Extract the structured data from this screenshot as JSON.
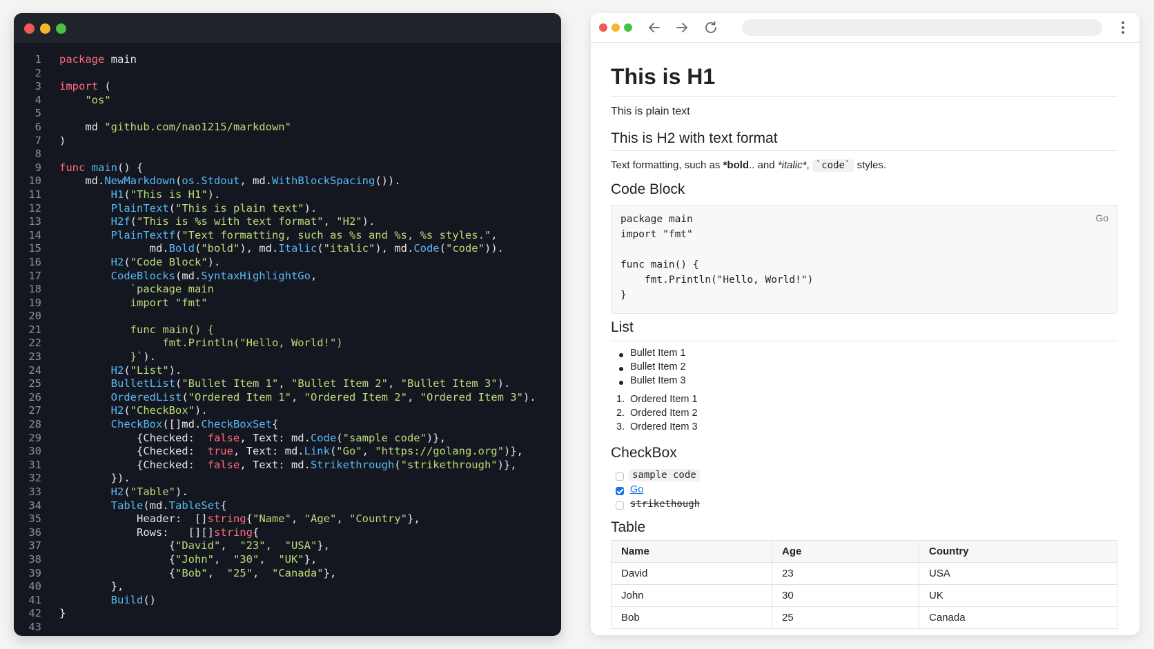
{
  "editor": {
    "code_lines": [
      [
        [
          "kw",
          "package"
        ],
        [
          "pl",
          " main"
        ]
      ],
      [],
      [
        [
          "kw",
          "import"
        ],
        [
          "pl",
          " ("
        ]
      ],
      [
        [
          "pl",
          "    "
        ],
        [
          "str",
          "\"os\""
        ]
      ],
      [],
      [
        [
          "pl",
          "    md "
        ],
        [
          "str",
          "\"github.com/nao1215/markdown\""
        ]
      ],
      [
        [
          "pl",
          ")"
        ]
      ],
      [],
      [
        [
          "kw",
          "func"
        ],
        [
          "pl",
          " "
        ],
        [
          "fn",
          "main"
        ],
        [
          "pl",
          "() {"
        ]
      ],
      [
        [
          "pl",
          "    md."
        ],
        [
          "fn",
          "NewMarkdown"
        ],
        [
          "pl",
          "("
        ],
        [
          "fn",
          "os.Stdout"
        ],
        [
          "pl",
          ", md."
        ],
        [
          "fn",
          "WithBlockSpacing"
        ],
        [
          "pl",
          "())."
        ]
      ],
      [
        [
          "pl",
          "        "
        ],
        [
          "fn",
          "H1"
        ],
        [
          "pl",
          "("
        ],
        [
          "str",
          "\"This is H1\""
        ],
        [
          "pl",
          ")."
        ]
      ],
      [
        [
          "pl",
          "        "
        ],
        [
          "fn",
          "PlainText"
        ],
        [
          "pl",
          "("
        ],
        [
          "str",
          "\"This is plain text\""
        ],
        [
          "pl",
          ")."
        ]
      ],
      [
        [
          "pl",
          "        "
        ],
        [
          "fn",
          "H2f"
        ],
        [
          "pl",
          "("
        ],
        [
          "str",
          "\"This is %s with text format\""
        ],
        [
          "pl",
          ", "
        ],
        [
          "str",
          "\"H2\""
        ],
        [
          "pl",
          ")."
        ]
      ],
      [
        [
          "pl",
          "        "
        ],
        [
          "fn",
          "PlainTextf"
        ],
        [
          "pl",
          "("
        ],
        [
          "str",
          "\"Text formatting, such as %s and %s, %s styles.\""
        ],
        [
          "pl",
          ","
        ]
      ],
      [
        [
          "pl",
          "              md."
        ],
        [
          "fn",
          "Bold"
        ],
        [
          "pl",
          "("
        ],
        [
          "str",
          "\"bold\""
        ],
        [
          "pl",
          "), md."
        ],
        [
          "fn",
          "Italic"
        ],
        [
          "pl",
          "("
        ],
        [
          "str",
          "\"italic\""
        ],
        [
          "pl",
          "), md."
        ],
        [
          "fn",
          "Code"
        ],
        [
          "pl",
          "("
        ],
        [
          "str",
          "\"code\""
        ],
        [
          "pl",
          "))."
        ]
      ],
      [
        [
          "pl",
          "        "
        ],
        [
          "fn",
          "H2"
        ],
        [
          "pl",
          "("
        ],
        [
          "str",
          "\"Code Block\""
        ],
        [
          "pl",
          ")."
        ]
      ],
      [
        [
          "pl",
          "        "
        ],
        [
          "fn",
          "CodeBlocks"
        ],
        [
          "pl",
          "(md."
        ],
        [
          "fn",
          "SyntaxHighlightGo"
        ],
        [
          "pl",
          ","
        ]
      ],
      [
        [
          "pl",
          "           "
        ],
        [
          "str",
          "`package main"
        ]
      ],
      [
        [
          "pl",
          "           "
        ],
        [
          "str",
          "import \"fmt\""
        ]
      ],
      [],
      [
        [
          "pl",
          "           "
        ],
        [
          "str",
          "func main() {"
        ]
      ],
      [
        [
          "pl",
          "                "
        ],
        [
          "str",
          "fmt.Println(\"Hello, World!\")"
        ]
      ],
      [
        [
          "pl",
          "           "
        ],
        [
          "str",
          "}`"
        ],
        [
          "pl",
          ")."
        ]
      ],
      [
        [
          "pl",
          "        "
        ],
        [
          "fn",
          "H2"
        ],
        [
          "pl",
          "("
        ],
        [
          "str",
          "\"List\""
        ],
        [
          "pl",
          ")."
        ]
      ],
      [
        [
          "pl",
          "        "
        ],
        [
          "fn",
          "BulletList"
        ],
        [
          "pl",
          "("
        ],
        [
          "str",
          "\"Bullet Item 1\""
        ],
        [
          "pl",
          ", "
        ],
        [
          "str",
          "\"Bullet Item 2\""
        ],
        [
          "pl",
          ", "
        ],
        [
          "str",
          "\"Bullet Item 3\""
        ],
        [
          "pl",
          ")."
        ]
      ],
      [
        [
          "pl",
          "        "
        ],
        [
          "fn",
          "OrderedList"
        ],
        [
          "pl",
          "("
        ],
        [
          "str",
          "\"Ordered Item 1\""
        ],
        [
          "pl",
          ", "
        ],
        [
          "str",
          "\"Ordered Item 2\""
        ],
        [
          "pl",
          ", "
        ],
        [
          "str",
          "\"Ordered Item 3\""
        ],
        [
          "pl",
          ")."
        ]
      ],
      [
        [
          "pl",
          "        "
        ],
        [
          "fn",
          "H2"
        ],
        [
          "pl",
          "("
        ],
        [
          "str",
          "\"CheckBox\""
        ],
        [
          "pl",
          ")."
        ]
      ],
      [
        [
          "pl",
          "        "
        ],
        [
          "fn",
          "CheckBox"
        ],
        [
          "pl",
          "([]md."
        ],
        [
          "fn",
          "CheckBoxSet"
        ],
        [
          "pl",
          "{"
        ]
      ],
      [
        [
          "pl",
          "            {Checked:  "
        ],
        [
          "kw",
          "false"
        ],
        [
          "pl",
          ", Text: md."
        ],
        [
          "fn",
          "Code"
        ],
        [
          "pl",
          "("
        ],
        [
          "str",
          "\"sample code\""
        ],
        [
          "pl",
          ")},"
        ]
      ],
      [
        [
          "pl",
          "            {Checked:  "
        ],
        [
          "kw",
          "true"
        ],
        [
          "pl",
          ", Text: md."
        ],
        [
          "fn",
          "Link"
        ],
        [
          "pl",
          "("
        ],
        [
          "str",
          "\"Go\""
        ],
        [
          "pl",
          ", "
        ],
        [
          "str",
          "\"https://golang.org\""
        ],
        [
          "pl",
          ")},"
        ]
      ],
      [
        [
          "pl",
          "            {Checked:  "
        ],
        [
          "kw",
          "false"
        ],
        [
          "pl",
          ", Text: md."
        ],
        [
          "fn",
          "Strikethrough"
        ],
        [
          "pl",
          "("
        ],
        [
          "str",
          "\"strikethrough\""
        ],
        [
          "pl",
          ")},"
        ]
      ],
      [
        [
          "pl",
          "        })."
        ]
      ],
      [
        [
          "pl",
          "        "
        ],
        [
          "fn",
          "H2"
        ],
        [
          "pl",
          "("
        ],
        [
          "str",
          "\"Table\""
        ],
        [
          "pl",
          ")."
        ]
      ],
      [
        [
          "pl",
          "        "
        ],
        [
          "fn",
          "Table"
        ],
        [
          "pl",
          "(md."
        ],
        [
          "fn",
          "TableSet"
        ],
        [
          "pl",
          "{"
        ]
      ],
      [
        [
          "pl",
          "            Header:  []"
        ],
        [
          "kw",
          "string"
        ],
        [
          "pl",
          "{"
        ],
        [
          "str",
          "\"Name\""
        ],
        [
          "pl",
          ", "
        ],
        [
          "str",
          "\"Age\""
        ],
        [
          "pl",
          ", "
        ],
        [
          "str",
          "\"Country\""
        ],
        [
          "pl",
          "},"
        ]
      ],
      [
        [
          "pl",
          "            Rows:   [][]"
        ],
        [
          "kw",
          "string"
        ],
        [
          "pl",
          "{"
        ]
      ],
      [
        [
          "pl",
          "                 {"
        ],
        [
          "str",
          "\"David\""
        ],
        [
          "pl",
          ",  "
        ],
        [
          "str",
          "\"23\""
        ],
        [
          "pl",
          ",  "
        ],
        [
          "str",
          "\"USA\""
        ],
        [
          "pl",
          "},"
        ]
      ],
      [
        [
          "pl",
          "                 {"
        ],
        [
          "str",
          "\"John\""
        ],
        [
          "pl",
          ",  "
        ],
        [
          "str",
          "\"30\""
        ],
        [
          "pl",
          ",  "
        ],
        [
          "str",
          "\"UK\""
        ],
        [
          "pl",
          "},"
        ]
      ],
      [
        [
          "pl",
          "                 {"
        ],
        [
          "str",
          "\"Bob\""
        ],
        [
          "pl",
          ",  "
        ],
        [
          "str",
          "\"25\""
        ],
        [
          "pl",
          ",  "
        ],
        [
          "str",
          "\"Canada\""
        ],
        [
          "pl",
          "},"
        ]
      ],
      [
        [
          "pl",
          "        },"
        ]
      ],
      [
        [
          "pl",
          "        "
        ],
        [
          "fn",
          "Build"
        ],
        [
          "pl",
          "()"
        ]
      ],
      [
        [
          "pl",
          "}"
        ]
      ],
      []
    ],
    "colors": {
      "keyword": "#ff6b7f",
      "string": "#b8dd7a",
      "function": "#59b9f7",
      "background": "#14171f"
    }
  },
  "preview": {
    "h1": "This is H1",
    "plain_text": "This is plain text",
    "h2_format": "This is H2 with text format",
    "format_line": {
      "before": "Text formatting, such as ",
      "bold": "*bold",
      "bold_suffix": "..",
      "middle": " and ",
      "italic": "*italic*",
      "comma": ", ",
      "code": "`code`",
      "after": " styles."
    },
    "h2_code_block": "Code Block",
    "code_block": {
      "lang": "Go",
      "lines": [
        "package main",
        "import \"fmt\"",
        "",
        "func main() {",
        "    fmt.Println(\"Hello, World!\")",
        "}"
      ]
    },
    "h2_list": "List",
    "bullets": [
      "Bullet Item 1",
      "Bullet Item 2",
      "Bullet Item 3"
    ],
    "ordered": [
      {
        "num": "1.",
        "text": "Ordered Item 1"
      },
      {
        "num": "2.",
        "text": "Ordered Item 2"
      },
      {
        "num": "3.",
        "text": "Ordered Item 3"
      }
    ],
    "h2_checkbox": "CheckBox",
    "checkboxes": [
      {
        "label": "sample code",
        "checked": false
      },
      {
        "label": "Go",
        "checked": true
      },
      {
        "label": "strikethough",
        "checked": false
      }
    ],
    "h2_table": "Table",
    "table": {
      "headers": [
        "Name",
        "Age",
        "Country"
      ],
      "rows": [
        [
          "David",
          "23",
          "USA"
        ],
        [
          "John",
          "30",
          "UK"
        ],
        [
          "Bob",
          "25",
          "Canada"
        ]
      ]
    }
  },
  "icons": {
    "back": "arrow-left-icon",
    "forward": "arrow-right-icon",
    "reload": "reload-icon",
    "menu": "kebab-menu-icon"
  }
}
